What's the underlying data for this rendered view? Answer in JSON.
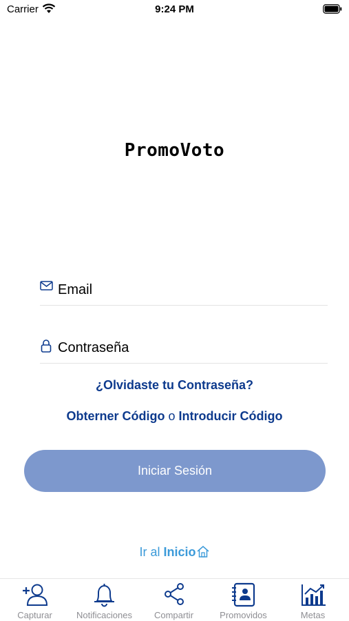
{
  "status_bar": {
    "carrier": "Carrier",
    "time": "9:24 PM"
  },
  "app": {
    "logo_text": "PromoVoto"
  },
  "form": {
    "email_placeholder": "Email",
    "password_placeholder": "Contraseña",
    "forgot_password": "¿Olvidaste tu Contraseña?",
    "get_code": "Obterner Código",
    "or_text": "o",
    "enter_code": "Introducir Código",
    "login_button": "Iniciar Sesión"
  },
  "home_link": {
    "prefix": "Ir al",
    "label": "Inicio"
  },
  "tab_bar": {
    "items": [
      {
        "label": "Capturar",
        "icon": "add-person-icon"
      },
      {
        "label": "Notificaciones",
        "icon": "bell-icon"
      },
      {
        "label": "Compartir",
        "icon": "share-icon"
      },
      {
        "label": "Promovidos",
        "icon": "contacts-book-icon"
      },
      {
        "label": "Metas",
        "icon": "chart-icon"
      }
    ]
  },
  "colors": {
    "primary": "#0d3a8d",
    "button_bg": "#7d98cd",
    "link_light": "#3b9ad9",
    "tab_label": "#8e8e93"
  }
}
